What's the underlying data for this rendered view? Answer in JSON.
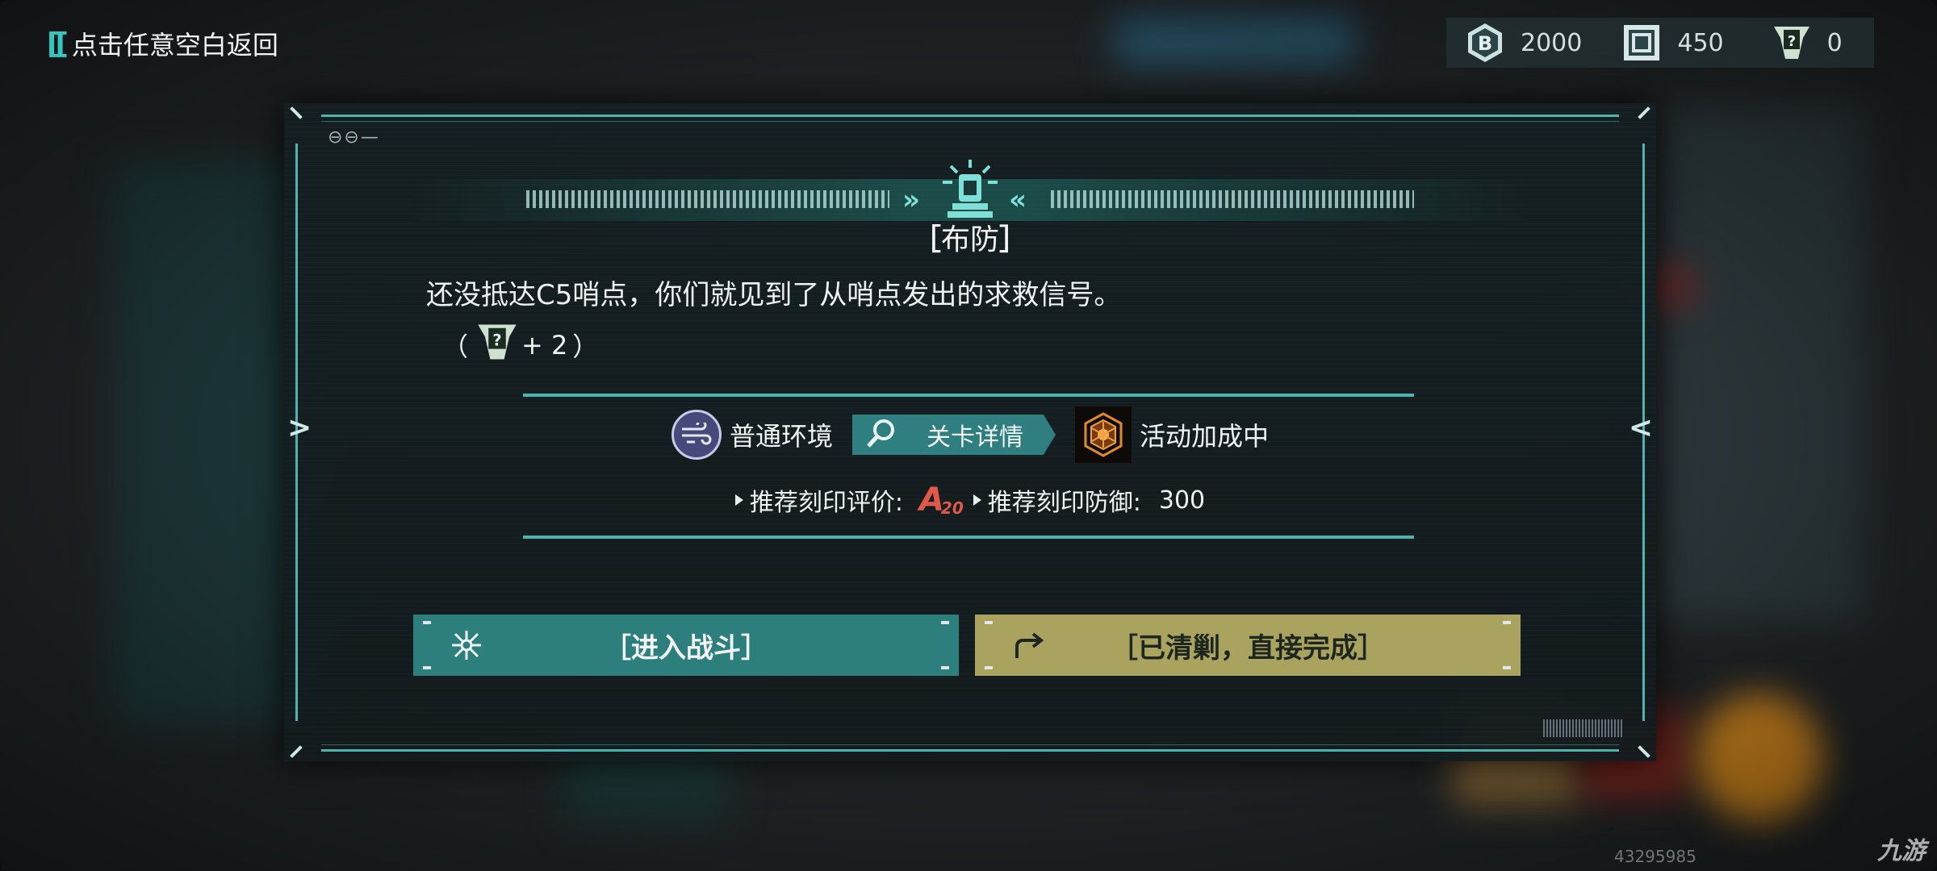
{
  "topbar": {
    "back_hint": "点击任意空白返回",
    "currencies": [
      {
        "icon": "b-coin-icon",
        "value": "2000"
      },
      {
        "icon": "chip-icon",
        "value": "450"
      },
      {
        "icon": "question-tag-icon",
        "value": "0"
      }
    ]
  },
  "dialog": {
    "title": "布防",
    "description": "还没抵达C5哨点，你们就见到了从哨点发出的求救信号。",
    "reward": {
      "open": "（",
      "icon": "question-tag-icon",
      "amount": "+ 2",
      "close": "）"
    },
    "environment_label": "普通环境",
    "detail_button": "关卡详情",
    "bonus_label": "活动加成中",
    "recommend_rating_label": "推荐刻印评价:",
    "recommend_rating_letter": "A",
    "recommend_rating_number": "20",
    "recommend_defense_label": "推荐刻印防御:",
    "recommend_defense_value": "300",
    "fight_button": "［进入战斗］",
    "skip_button": "［已清剿，直接完成］"
  },
  "footer": {
    "id": "43295985",
    "watermark": "九游"
  },
  "colors": {
    "accent_teal": "#2c7f7c",
    "accent_gold": "#a9a35f",
    "line": "#4fb3b0",
    "rating_red": "#e0584a"
  }
}
